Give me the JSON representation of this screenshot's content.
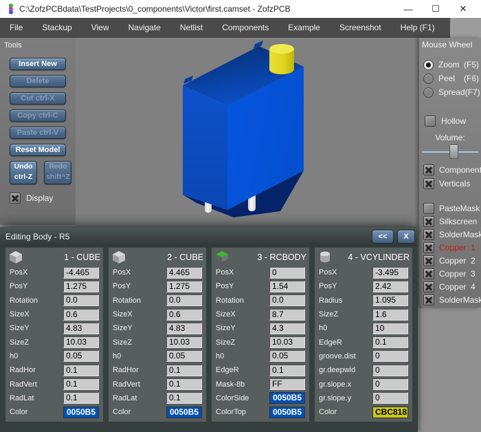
{
  "window": {
    "title": "C:\\ZofzPCBdata\\TestProjects\\0_components\\Victor\\first.camset - ZofzPCB",
    "controls": {
      "minimize": "—",
      "maximize": "☐",
      "close": "✕"
    }
  },
  "menu": {
    "items": [
      "File",
      "Stackup",
      "View",
      "Navigate",
      "Netlist",
      "Components",
      "Example",
      "Screenshot",
      "Help (F1)"
    ]
  },
  "tools": {
    "title": "Tools",
    "buttons": [
      {
        "label": "Insert New",
        "enabled": true
      },
      {
        "label": "Delete",
        "enabled": false
      },
      {
        "label": "Cut  ctrl-X",
        "enabled": false
      },
      {
        "label": "Copy ctrl-C",
        "enabled": false
      },
      {
        "label": "Paste ctrl-V",
        "enabled": false
      },
      {
        "label": "Reset Model",
        "enabled": true
      }
    ],
    "undo": {
      "label": "Undo\nctrl-Z",
      "enabled": true
    },
    "redo": {
      "label": "Redo\nshift^Z",
      "enabled": false
    },
    "display": {
      "label": "Display",
      "checked": true
    }
  },
  "sidebar": {
    "title": "Mouse Wheel",
    "radios": [
      {
        "label": "Zoom",
        "shortcut": "(F5)",
        "selected": true
      },
      {
        "label": "Peel",
        "shortcut": "(F6)",
        "selected": false
      },
      {
        "label": "Spread",
        "shortcut": "(F7)",
        "selected": false
      }
    ],
    "hollow": {
      "label": "Hollow",
      "checked": false
    },
    "volume_label": "Volume:",
    "volume_percent": 57,
    "toggles": [
      {
        "label": "Components",
        "checked": true
      },
      {
        "label": "Verticals",
        "checked": true
      }
    ],
    "layers": [
      {
        "label": "PasteMask",
        "checked": false
      },
      {
        "label": "Silkscreen",
        "checked": true
      },
      {
        "label": "SolderMask",
        "checked": true
      },
      {
        "label": "Copper  1",
        "checked": true,
        "color": "#c41a1a"
      },
      {
        "label": "Copper  2",
        "checked": true
      },
      {
        "label": "Copper  3",
        "checked": true
      },
      {
        "label": "Copper  4",
        "checked": true
      },
      {
        "label": "SolderMask",
        "checked": true
      }
    ]
  },
  "viewport": {
    "model_colors": {
      "body": "#0050B5",
      "screw": "#CBC818",
      "pins": "#EDEDED",
      "background": "#808080"
    }
  },
  "editor": {
    "title": "Editing Body - R5",
    "collapse_label": "<<",
    "close_label": "X",
    "columns": [
      {
        "title": "1 - CUBE",
        "icon": "cube",
        "rows": [
          {
            "label": "PosX",
            "value": "-4.465"
          },
          {
            "label": "PosY",
            "value": "1.275"
          },
          {
            "label": "Rotation",
            "value": "0.0"
          },
          {
            "label": "SizeX",
            "value": "0.6"
          },
          {
            "label": "SizeY",
            "value": "4.83"
          },
          {
            "label": "SizeZ",
            "value": "10.03"
          },
          {
            "label": "h0",
            "value": "0.05"
          },
          {
            "label": "RadHor",
            "value": "0.1"
          },
          {
            "label": "RadVert",
            "value": "0.1"
          },
          {
            "label": "RadLat",
            "value": "0.1"
          },
          {
            "label": "Color",
            "value": "0050B5",
            "bg": "#0050B5",
            "fg": "#ffffff"
          }
        ]
      },
      {
        "title": "2 - CUBE",
        "icon": "cube",
        "rows": [
          {
            "label": "PosX",
            "value": "4.465"
          },
          {
            "label": "PosY",
            "value": "1.275"
          },
          {
            "label": "Rotation",
            "value": "0.0"
          },
          {
            "label": "SizeX",
            "value": "0.6"
          },
          {
            "label": "SizeY",
            "value": "4.83"
          },
          {
            "label": "SizeZ",
            "value": "10.03"
          },
          {
            "label": "h0",
            "value": "0.05"
          },
          {
            "label": "RadHor",
            "value": "0.1"
          },
          {
            "label": "RadVert",
            "value": "0.1"
          },
          {
            "label": "RadLat",
            "value": "0.1"
          },
          {
            "label": "Color",
            "value": "0050B5",
            "bg": "#0050B5",
            "fg": "#ffffff"
          }
        ]
      },
      {
        "title": "3 - RCBODY",
        "icon": "rcbody",
        "rows": [
          {
            "label": "PosX",
            "value": "0"
          },
          {
            "label": "PosY",
            "value": "1.54"
          },
          {
            "label": "Rotation",
            "value": "0.0"
          },
          {
            "label": "SizeX",
            "value": "8.7"
          },
          {
            "label": "SizeY",
            "value": "4.3"
          },
          {
            "label": "SizeZ",
            "value": "10.03"
          },
          {
            "label": "h0",
            "value": "0.05"
          },
          {
            "label": "EdgeR",
            "value": "0.1"
          },
          {
            "label": "Mask-8b",
            "value": "FF"
          },
          {
            "label": "ColorSide",
            "value": "0050B5",
            "bg": "#0050B5",
            "fg": "#ffffff"
          },
          {
            "label": "ColorTop",
            "value": "0050B5",
            "bg": "#0050B5",
            "fg": "#ffffff"
          }
        ]
      },
      {
        "title": "4 - VCYLINDER",
        "icon": "cylinder",
        "rows": [
          {
            "label": "PosX",
            "value": "-3.495"
          },
          {
            "label": "PosY",
            "value": "2.42"
          },
          {
            "label": "Radius",
            "value": "1.095"
          },
          {
            "label": "SizeZ",
            "value": "1.6"
          },
          {
            "label": "h0",
            "value": "10"
          },
          {
            "label": "EdgeR",
            "value": "0.1"
          },
          {
            "label": "groove.dist",
            "value": "0"
          },
          {
            "label": "gr.deepwid",
            "value": "0"
          },
          {
            "label": "gr.slope.x",
            "value": "0"
          },
          {
            "label": "gr.slope.y",
            "value": "0"
          },
          {
            "label": "Color",
            "value": "CBC818",
            "bg": "#CBC818",
            "fg": "#000000"
          }
        ]
      }
    ]
  }
}
